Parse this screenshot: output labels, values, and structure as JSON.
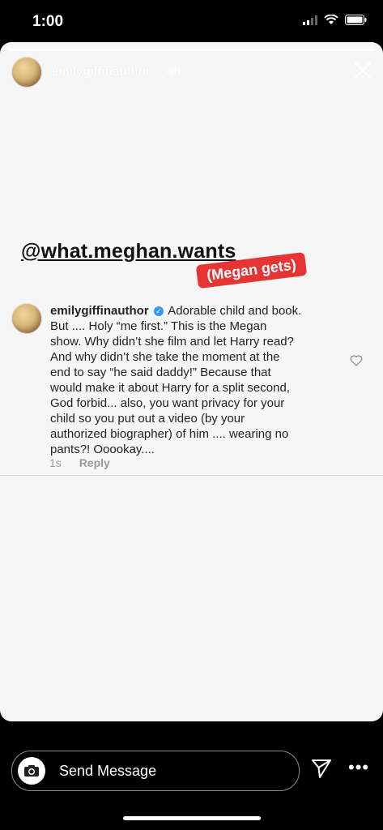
{
  "status_bar": {
    "time": "1:00"
  },
  "story": {
    "progress": 1.0,
    "username": "emilygiffinauthor",
    "time_ago": "4h",
    "mention": "@what.meghan.wants",
    "sticker": "(Megan gets)"
  },
  "comment": {
    "author": "emilygiffinauthor",
    "text": "Adorable child and book.\nBut .... Holy “me first.”  This is the Megan\nshow. Why didn’t she film and let Harry read?\nAnd why didn’t she take the moment at the\nend to say “he said daddy!”  Because that\nwould make it about Harry for a split second,\nGod forbid... also, you want privacy for your\nchild so you put out a video (by your\nauthorized biographer) of him .... wearing no\npants?! Ooookay....",
    "time": "1s",
    "reply_label": "Reply"
  },
  "footer": {
    "message_placeholder": "Send Message"
  },
  "colors": {
    "sticker_red": "#e53434",
    "verified_blue": "#3897f0"
  }
}
